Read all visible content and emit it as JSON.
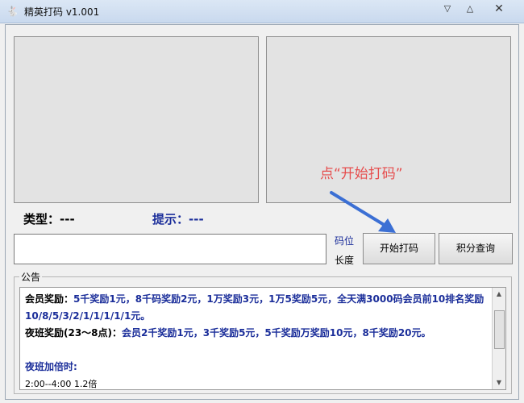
{
  "window": {
    "title": "精英打码 v1.001",
    "minimize_glyph": "▽",
    "maximize_glyph": "△",
    "close_glyph": "✕"
  },
  "labels": {
    "type": "类型：---",
    "hint": "提示：---",
    "instruction": "点“开始打码”",
    "code_position": "码位",
    "length": "长度"
  },
  "code_input": {
    "value": "",
    "placeholder": ""
  },
  "buttons": {
    "start": "开始打码",
    "points_query": "积分查询"
  },
  "notice": {
    "legend": "公告",
    "lines": {
      "l1_label": "会员奖励：",
      "l1_text": "5千奖励1元，8千码奖励2元，1万奖励3元，1万5奖励5元，全天满3000码会员前10排名奖励10/8/5/3/2/1/1/1/1/1元。",
      "l2_label": "夜班奖励(23～8点)：",
      "l2_text": "会员2千奖励1元，3千奖励5元，5千奖励万奖励10元，8千奖励20元。",
      "l3": "夜班加倍时:",
      "l4": "2:00--4:00 1.2倍"
    }
  },
  "colors": {
    "accent_blue": "#1b2e9a",
    "instruction_red": "#e64d4d",
    "arrow_blue": "#3b6fd4"
  },
  "icons": {
    "app": "app-logo-icon",
    "scroll_up": "chevron-up-icon",
    "scroll_down": "chevron-down-icon"
  }
}
